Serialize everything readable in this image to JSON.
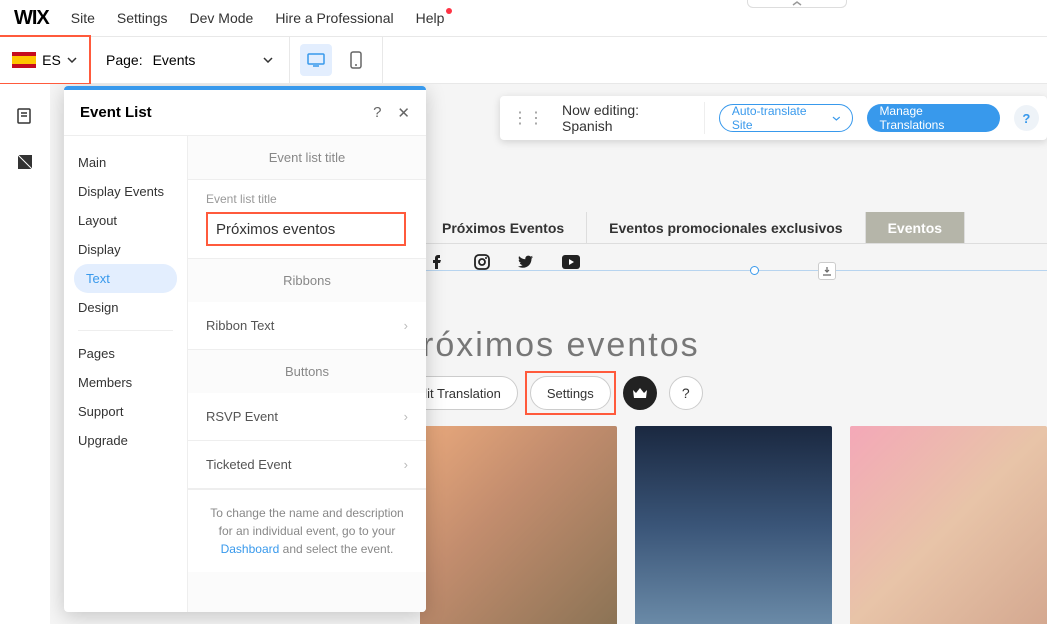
{
  "logo": "WIX",
  "topMenu": {
    "site": "Site",
    "settings": "Settings",
    "devmode": "Dev Mode",
    "hire": "Hire a Professional",
    "help": "Help"
  },
  "lang": {
    "code": "ES"
  },
  "pageRow": {
    "label": "Page:",
    "value": "Events"
  },
  "floatBar": {
    "text": "Now editing: Spanish",
    "autoTranslate": "Auto-translate Site",
    "manage": "Manage Translations"
  },
  "panel": {
    "title": "Event List",
    "nav": {
      "main": "Main",
      "displayEvents": "Display Events",
      "layout": "Layout",
      "display": "Display",
      "text": "Text",
      "design": "Design",
      "pages": "Pages",
      "members": "Members",
      "support": "Support",
      "upgrade": "Upgrade"
    },
    "sections": {
      "eventListTitle": "Event list title",
      "fieldLabel": "Event list title",
      "fieldValue": "Próximos eventos",
      "ribbons": "Ribbons",
      "ribbonText": "Ribbon Text",
      "buttons": "Buttons",
      "rsvp": "RSVP Event",
      "ticketed": "Ticketed Event"
    },
    "footer": {
      "l1": "To change the name and description for an individual event, go to your ",
      "link": "Dashboard",
      "l2": " and select the event."
    }
  },
  "tabs": {
    "t1": "Próximos Eventos",
    "t2": "Eventos promocionales exclusivos",
    "t3": "Eventos"
  },
  "hero": {
    "title": "Próximos eventos",
    "edit": "Edit Translation",
    "settings": "Settings"
  }
}
